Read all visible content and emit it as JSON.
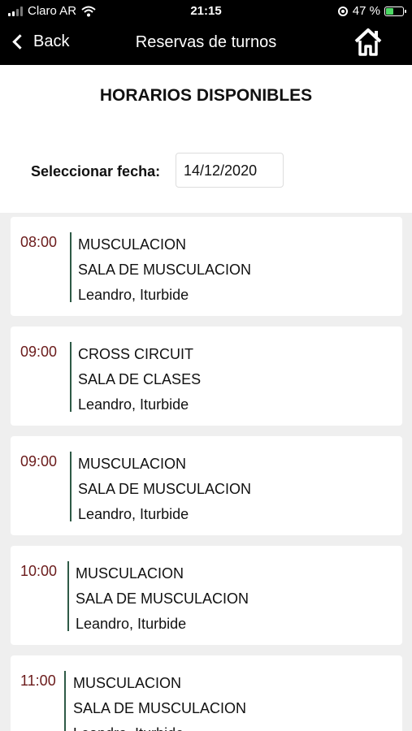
{
  "status": {
    "carrier": "Claro AR",
    "time": "21:15",
    "battery": "47 %",
    "battery_level": 0.47
  },
  "nav": {
    "back_label": "Back",
    "title": "Reservas de turnos"
  },
  "page": {
    "heading": "HORARIOS DISPONIBLES",
    "date_label": "Seleccionar fecha:",
    "date_value": "14/12/2020"
  },
  "slots": [
    {
      "time": "08:00",
      "activity": "MUSCULACION",
      "room": "SALA DE MUSCULACION",
      "instructor": "Leandro, Iturbide"
    },
    {
      "time": "09:00",
      "activity": "CROSS CIRCUIT",
      "room": "SALA DE CLASES",
      "instructor": "Leandro, Iturbide"
    },
    {
      "time": "09:00",
      "activity": "MUSCULACION",
      "room": "SALA DE MUSCULACION",
      "instructor": "Leandro, Iturbide"
    },
    {
      "time": "10:00",
      "activity": "MUSCULACION",
      "room": "SALA DE MUSCULACION",
      "instructor": "Leandro, Iturbide"
    },
    {
      "time": "11:00",
      "activity": "MUSCULACION",
      "room": "SALA DE MUSCULACION",
      "instructor": "Leandro, Iturbide"
    }
  ],
  "colors": {
    "time_text": "#6b1b1b",
    "divider": "#2e5a46",
    "list_background": "#efefef"
  }
}
